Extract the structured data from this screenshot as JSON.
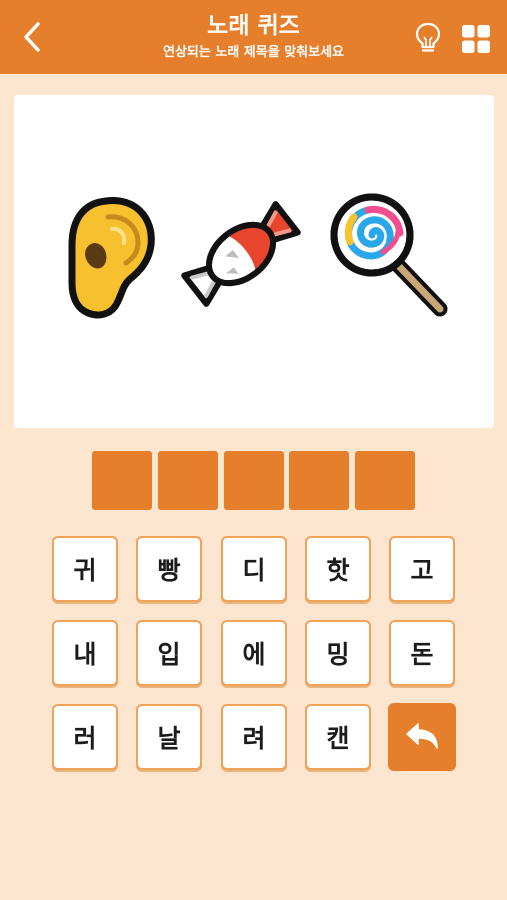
{
  "header": {
    "title": "노래 퀴즈",
    "subtitle": "연상되는 노래 제목을 맞춰보세요"
  },
  "icons": {
    "back": "chevron-left-icon",
    "hint": "lightbulb-icon",
    "menu": "grid-menu-icon",
    "undo": "undo-arrow-icon"
  },
  "puzzle": {
    "emojis": [
      "ear",
      "candy",
      "lollipop"
    ]
  },
  "answer": {
    "slots": [
      "",
      "",
      "",
      "",
      ""
    ]
  },
  "keyboard": {
    "row1": [
      "귀",
      "빵",
      "디",
      "핫",
      "고"
    ],
    "row2": [
      "내",
      "입",
      "에",
      "밍",
      "돈"
    ],
    "row3": [
      "러",
      "날",
      "려",
      "캔"
    ]
  },
  "colors": {
    "accent": "#e57f2c",
    "background": "#fce6cf",
    "key_border": "#f0a259"
  }
}
